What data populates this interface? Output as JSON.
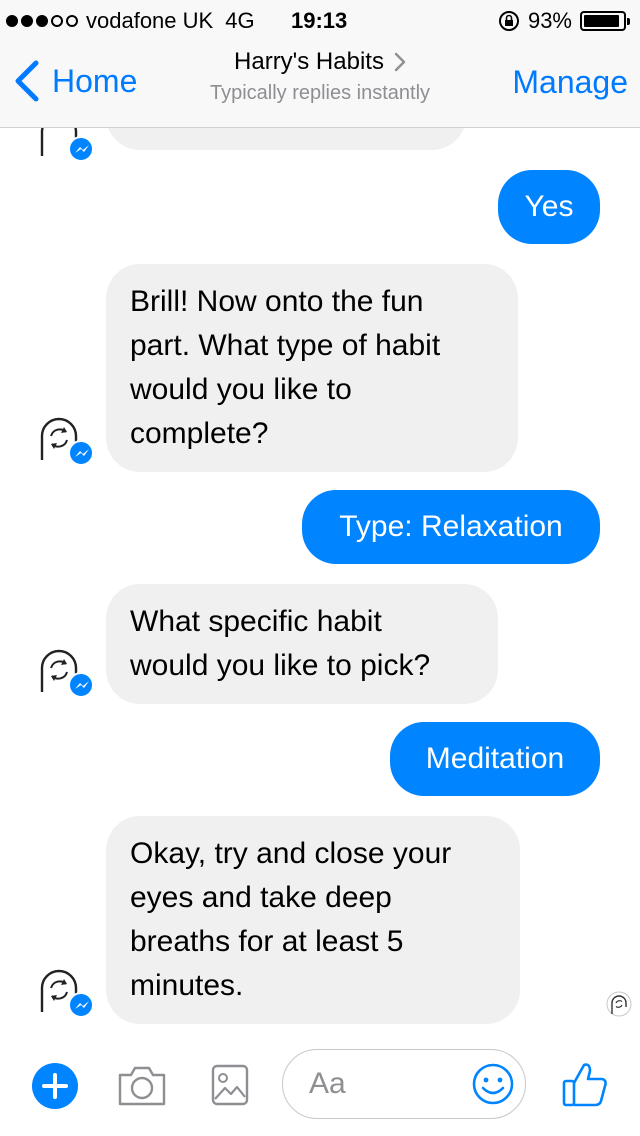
{
  "status_bar": {
    "carrier": "vodafone UK",
    "network": "4G",
    "time": "19:13",
    "battery_percent": "93%",
    "battery_level": 0.93,
    "signal_bars_filled": 3,
    "signal_bars_total": 5
  },
  "nav": {
    "back_label": "Home",
    "title": "Harry's Habits",
    "subtitle": "Typically replies instantly",
    "manage_label": "Manage"
  },
  "messages": [
    {
      "from": "bot",
      "lines": [
        "",
        ""
      ]
    },
    {
      "from": "user",
      "text": "Yes"
    },
    {
      "from": "bot",
      "lines": [
        "Brill! Now onto the fun",
        "part. What type of habit",
        "would you like to",
        "complete?"
      ]
    },
    {
      "from": "user",
      "text": "Type: Relaxation"
    },
    {
      "from": "bot",
      "lines": [
        "What specific habit",
        "would you like to pick?"
      ]
    },
    {
      "from": "user",
      "text": "Meditation"
    },
    {
      "from": "bot",
      "lines": [
        "Okay, try and close your",
        "eyes and take deep",
        "breaths for at least 5",
        "minutes."
      ]
    }
  ],
  "composer": {
    "placeholder": "Aa",
    "icons": [
      "plus-icon",
      "camera-icon",
      "image-icon",
      "smiley-icon",
      "thumbs-up-icon"
    ]
  },
  "colors": {
    "accent": "#007aff",
    "messenger_blue": "#0084ff",
    "bubble_gray": "#f0f0f0",
    "subtitle_gray": "#8e8e93"
  }
}
